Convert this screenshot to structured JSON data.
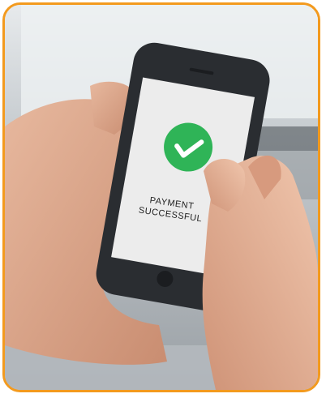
{
  "photo": {
    "status_line1": "PAYMENT",
    "status_line2": "SUCCESSFUL",
    "icon": "checkmark-circle-icon",
    "colors": {
      "frame_border": "#f39a1e",
      "success_green": "#2fb457",
      "phone_body": "#2a2d31",
      "phone_screen": "#ececec"
    }
  }
}
